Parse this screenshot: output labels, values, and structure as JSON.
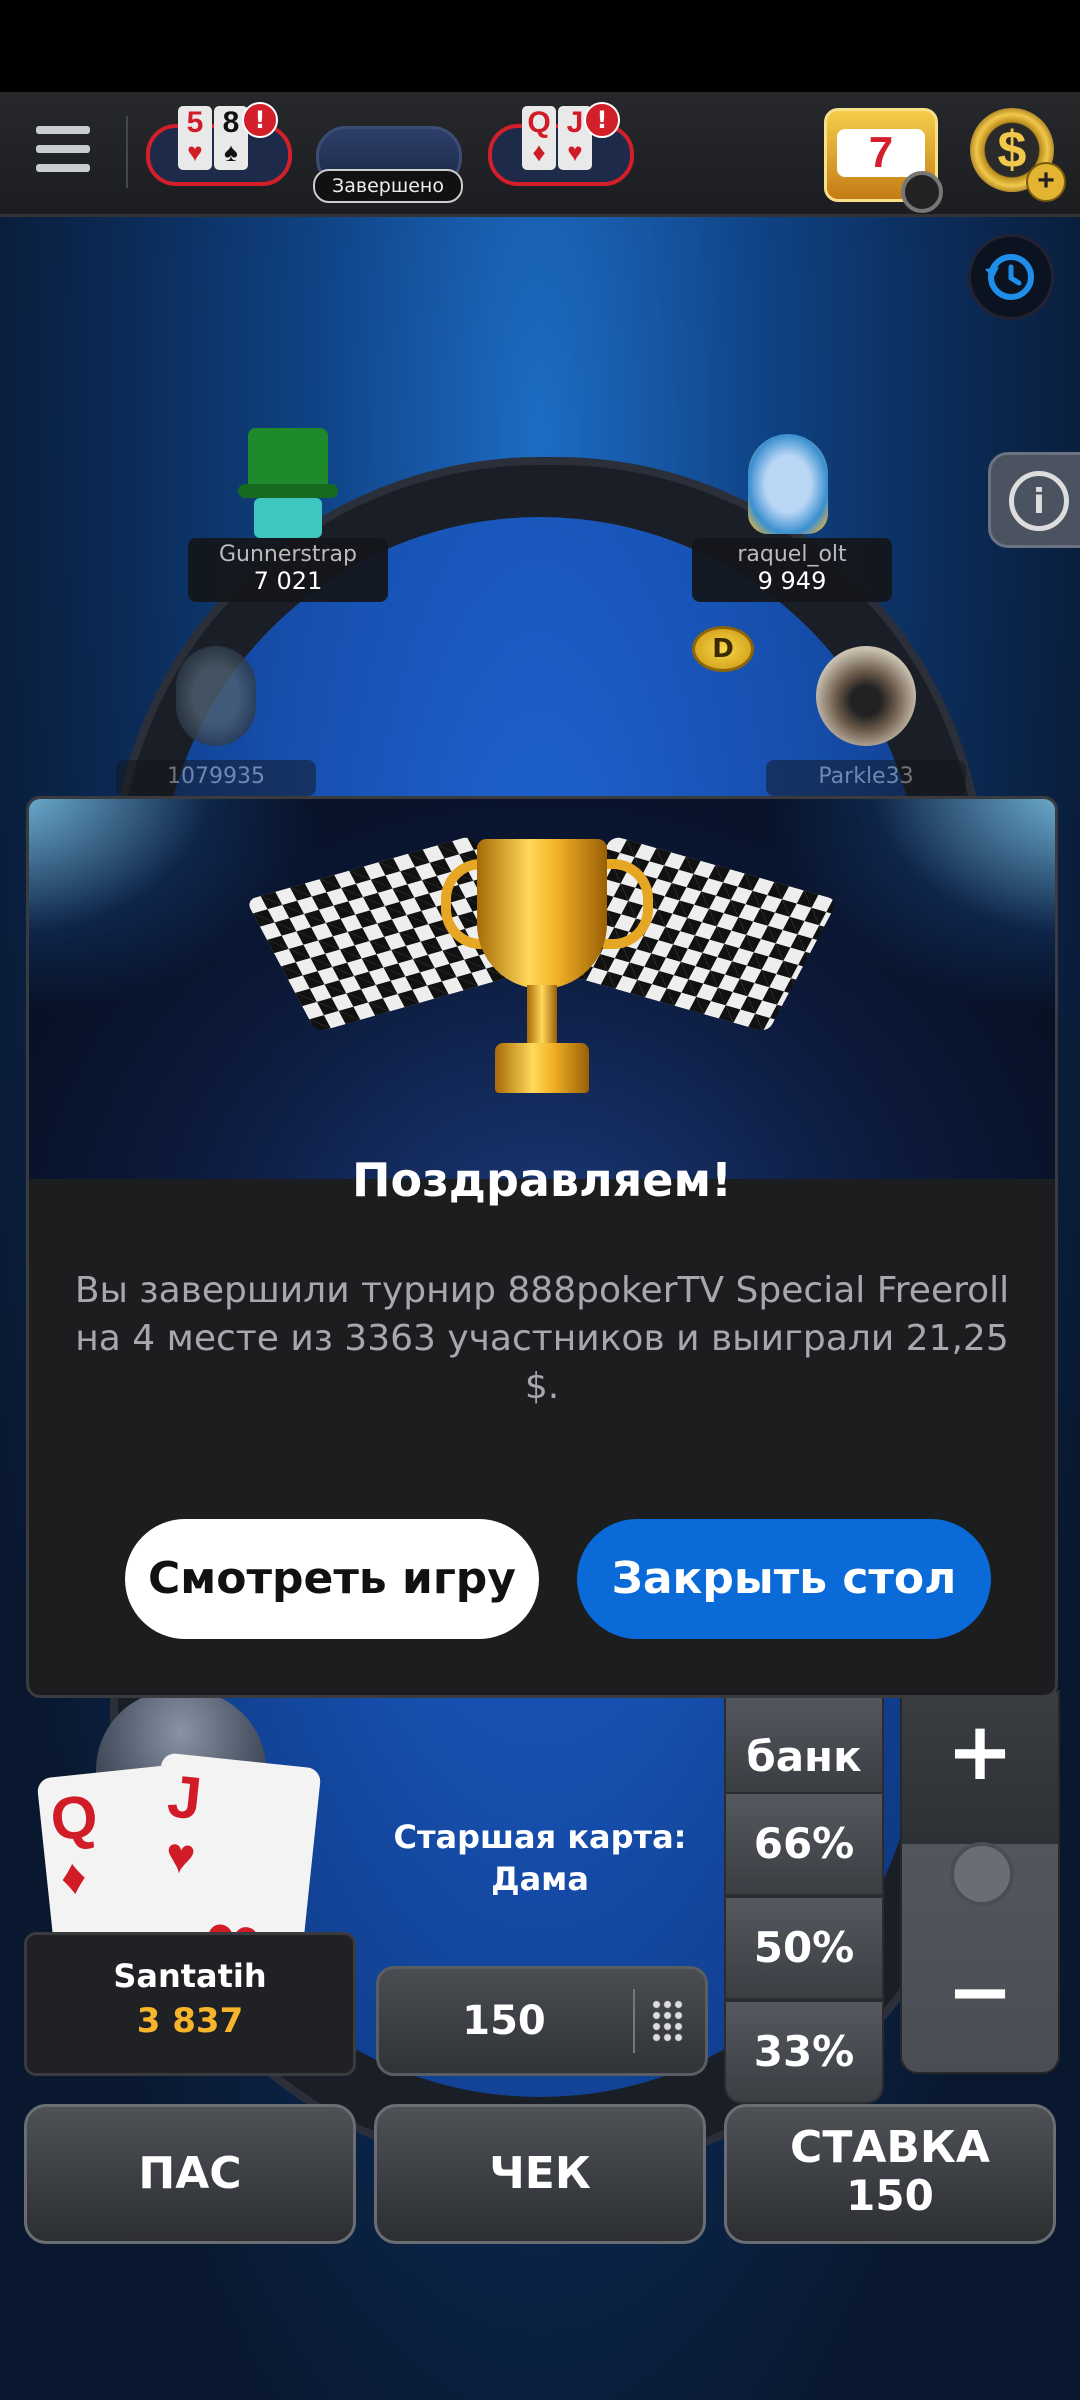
{
  "topbar": {
    "menu_icon": "hamburger-menu-icon",
    "tables": [
      {
        "rank1": "5",
        "suit1": "♥",
        "rank2": "8",
        "suit2": "♠",
        "alert": "!"
      },
      {
        "rank1": "Q",
        "suit1": "♦",
        "rank2": "J",
        "suit2": "♥",
        "alert": "!"
      }
    ],
    "pending_label": "Завершено",
    "slots_symbol": "7",
    "cashier_symbol": "$",
    "cashier_plus": "+"
  },
  "players": [
    {
      "name": "Gunnerstrap",
      "chips": "7 021"
    },
    {
      "name": "raquel_olt",
      "chips": "9 949"
    },
    {
      "name": "1079935",
      "chips": ""
    },
    {
      "name": "Parkle33",
      "chips": ""
    }
  ],
  "dealer_label": "D",
  "info_label": "i",
  "modal": {
    "title": "Поздравляем!",
    "message": "Вы завершили турнир 888pokerTV Special Freeroll на 4 месте из 3363 участников и выиграли 21,25 $.",
    "watch_button": "Смотреть игру",
    "close_button": "Закрыть стол"
  },
  "hero": {
    "name": "Santatih",
    "chips": "3 837",
    "cards": [
      {
        "rank": "Q",
        "suit": "♦"
      },
      {
        "rank": "J",
        "suit": "♥"
      }
    ],
    "hand_description": "Старшая карта: Дама"
  },
  "bet": {
    "value": "150",
    "pot_options": [
      "банк",
      "66%",
      "50%",
      "33%"
    ],
    "plus": "+",
    "minus": "−"
  },
  "actions": {
    "fold": "ПАС",
    "check": "ЧЕК",
    "bet_label": "СТАВКА",
    "bet_amount": "150"
  },
  "colors": {
    "accent_blue": "#0a6ad8",
    "alert_red": "#d21f2a",
    "chip_gold": "#f7b52c"
  }
}
